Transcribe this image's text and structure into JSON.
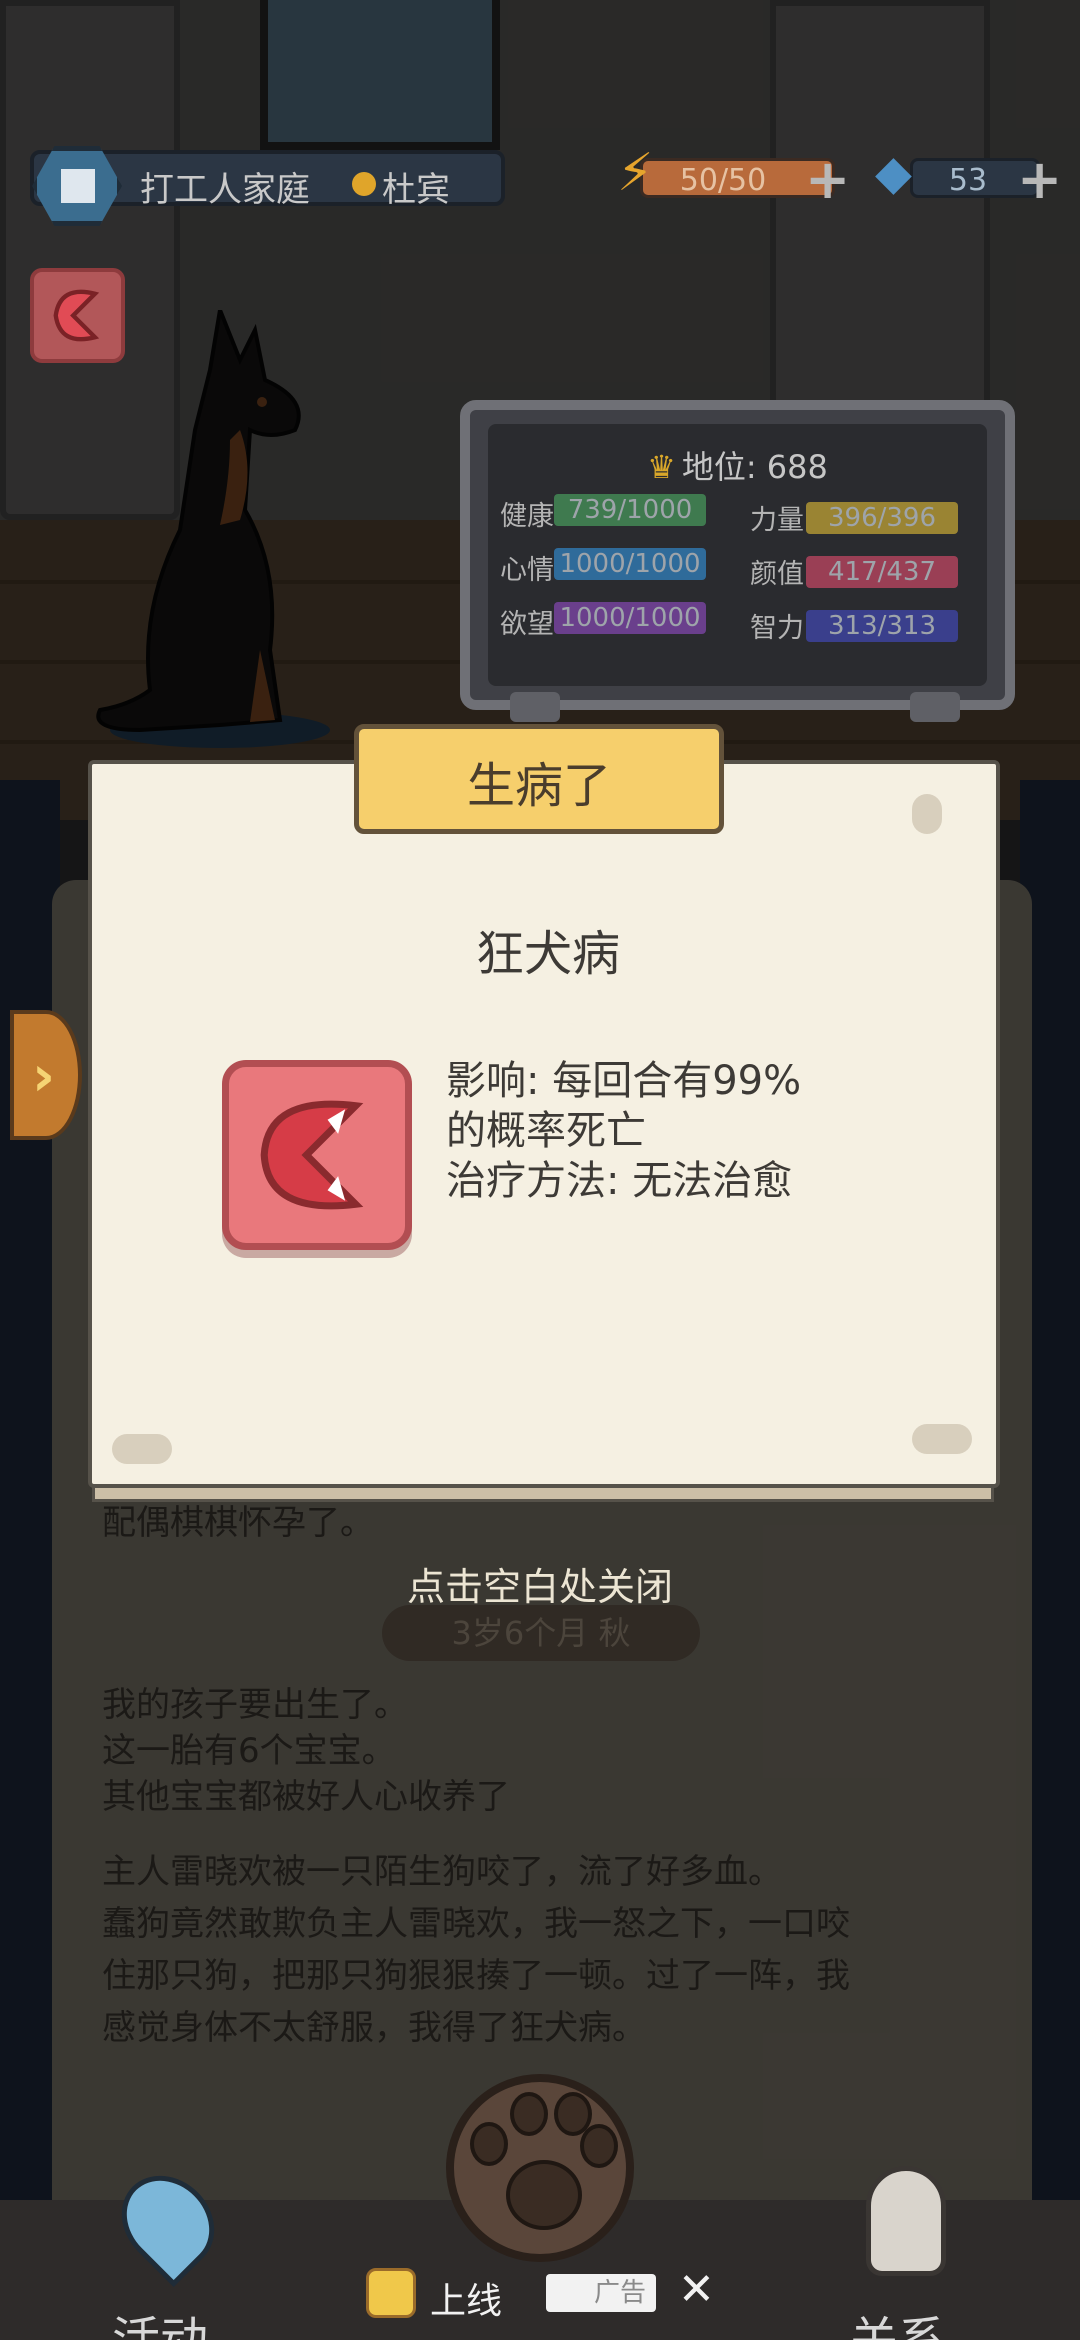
{
  "top_bar": {
    "family_name": "打工人家庭",
    "rank_name": "杜宾",
    "energy": "50/50",
    "gems": "53",
    "plus_glyph": "+"
  },
  "board": {
    "status_label": "地位: 688",
    "stats": [
      {
        "label": "健康",
        "value": "739/1000",
        "color": "#3f7a4f"
      },
      {
        "label": "心情",
        "value": "1000/1000",
        "color": "#2f6b9a"
      },
      {
        "label": "欲望",
        "value": "1000/1000",
        "color": "#6a3f8c"
      },
      {
        "label": "力量",
        "value": "396/396",
        "color": "#9a8433"
      },
      {
        "label": "颜值",
        "value": "417/437",
        "color": "#9a3f55"
      },
      {
        "label": "智力",
        "value": "313/313",
        "color": "#3a3f8c"
      }
    ]
  },
  "popup": {
    "title": "生病了",
    "disease_name": "狂犬病",
    "effect_line1": "影响: 每回合有99%",
    "effect_line2": "的概率死亡",
    "cure_line": "治疗方法: 无法治愈"
  },
  "diary": {
    "partner_line": "配偶棋棋怀孕了。",
    "close_hint": "点击空白处关闭",
    "age_label": "3岁6个月 秋",
    "paragraph1": [
      "我的孩子要出生了。",
      "这一胎有6个宝宝。",
      "其他宝宝都被好人心收养了"
    ],
    "paragraph2": [
      "主人雷晓欢被一只陌生狗咬了，流了好多血。",
      "蠢狗竟然敢欺负主人雷晓欢，我一怒之下，一口咬",
      "住那只狗，把那只狗狠狠揍了一顿。过了一阵，我",
      "感觉身体不太舒服，我得了狂犬病。"
    ]
  },
  "bottom_nav": {
    "activity_label": "活动",
    "relations_label": "关系",
    "ad_text": "上线",
    "ad_tag": "广告",
    "ad_close": "✕"
  },
  "icons": {
    "energy": "lightning-icon",
    "gem": "diamond-icon",
    "crown": "crown-icon",
    "disease": "rabies-mouth-icon",
    "side_tab": "chevron-right-icon"
  }
}
